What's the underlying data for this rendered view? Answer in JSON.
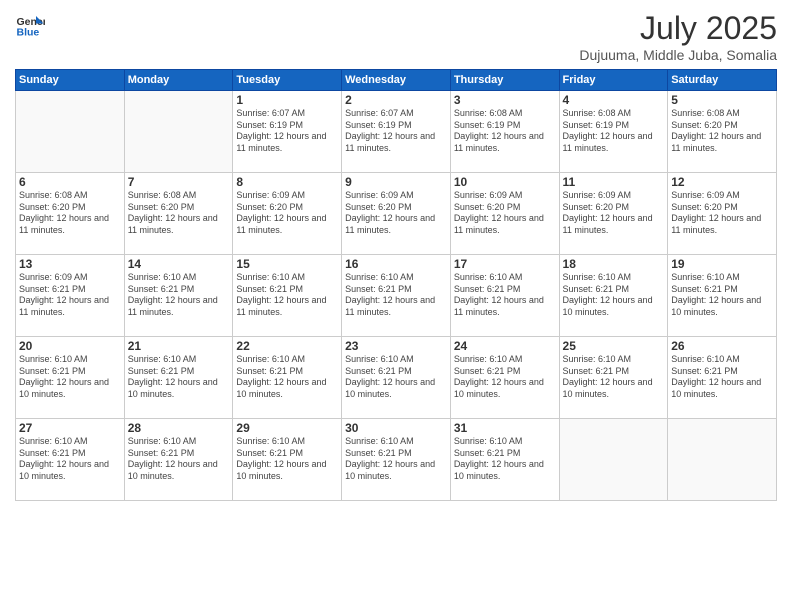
{
  "header": {
    "logo_general": "General",
    "logo_blue": "Blue",
    "title": "July 2025",
    "location": "Dujuuma, Middle Juba, Somalia"
  },
  "weekdays": [
    "Sunday",
    "Monday",
    "Tuesday",
    "Wednesday",
    "Thursday",
    "Friday",
    "Saturday"
  ],
  "weeks": [
    [
      {
        "day": "",
        "info": ""
      },
      {
        "day": "",
        "info": ""
      },
      {
        "day": "1",
        "info": "Sunrise: 6:07 AM\nSunset: 6:19 PM\nDaylight: 12 hours and 11 minutes."
      },
      {
        "day": "2",
        "info": "Sunrise: 6:07 AM\nSunset: 6:19 PM\nDaylight: 12 hours and 11 minutes."
      },
      {
        "day": "3",
        "info": "Sunrise: 6:08 AM\nSunset: 6:19 PM\nDaylight: 12 hours and 11 minutes."
      },
      {
        "day": "4",
        "info": "Sunrise: 6:08 AM\nSunset: 6:19 PM\nDaylight: 12 hours and 11 minutes."
      },
      {
        "day": "5",
        "info": "Sunrise: 6:08 AM\nSunset: 6:20 PM\nDaylight: 12 hours and 11 minutes."
      }
    ],
    [
      {
        "day": "6",
        "info": "Sunrise: 6:08 AM\nSunset: 6:20 PM\nDaylight: 12 hours and 11 minutes."
      },
      {
        "day": "7",
        "info": "Sunrise: 6:08 AM\nSunset: 6:20 PM\nDaylight: 12 hours and 11 minutes."
      },
      {
        "day": "8",
        "info": "Sunrise: 6:09 AM\nSunset: 6:20 PM\nDaylight: 12 hours and 11 minutes."
      },
      {
        "day": "9",
        "info": "Sunrise: 6:09 AM\nSunset: 6:20 PM\nDaylight: 12 hours and 11 minutes."
      },
      {
        "day": "10",
        "info": "Sunrise: 6:09 AM\nSunset: 6:20 PM\nDaylight: 12 hours and 11 minutes."
      },
      {
        "day": "11",
        "info": "Sunrise: 6:09 AM\nSunset: 6:20 PM\nDaylight: 12 hours and 11 minutes."
      },
      {
        "day": "12",
        "info": "Sunrise: 6:09 AM\nSunset: 6:20 PM\nDaylight: 12 hours and 11 minutes."
      }
    ],
    [
      {
        "day": "13",
        "info": "Sunrise: 6:09 AM\nSunset: 6:21 PM\nDaylight: 12 hours and 11 minutes."
      },
      {
        "day": "14",
        "info": "Sunrise: 6:10 AM\nSunset: 6:21 PM\nDaylight: 12 hours and 11 minutes."
      },
      {
        "day": "15",
        "info": "Sunrise: 6:10 AM\nSunset: 6:21 PM\nDaylight: 12 hours and 11 minutes."
      },
      {
        "day": "16",
        "info": "Sunrise: 6:10 AM\nSunset: 6:21 PM\nDaylight: 12 hours and 11 minutes."
      },
      {
        "day": "17",
        "info": "Sunrise: 6:10 AM\nSunset: 6:21 PM\nDaylight: 12 hours and 11 minutes."
      },
      {
        "day": "18",
        "info": "Sunrise: 6:10 AM\nSunset: 6:21 PM\nDaylight: 12 hours and 10 minutes."
      },
      {
        "day": "19",
        "info": "Sunrise: 6:10 AM\nSunset: 6:21 PM\nDaylight: 12 hours and 10 minutes."
      }
    ],
    [
      {
        "day": "20",
        "info": "Sunrise: 6:10 AM\nSunset: 6:21 PM\nDaylight: 12 hours and 10 minutes."
      },
      {
        "day": "21",
        "info": "Sunrise: 6:10 AM\nSunset: 6:21 PM\nDaylight: 12 hours and 10 minutes."
      },
      {
        "day": "22",
        "info": "Sunrise: 6:10 AM\nSunset: 6:21 PM\nDaylight: 12 hours and 10 minutes."
      },
      {
        "day": "23",
        "info": "Sunrise: 6:10 AM\nSunset: 6:21 PM\nDaylight: 12 hours and 10 minutes."
      },
      {
        "day": "24",
        "info": "Sunrise: 6:10 AM\nSunset: 6:21 PM\nDaylight: 12 hours and 10 minutes."
      },
      {
        "day": "25",
        "info": "Sunrise: 6:10 AM\nSunset: 6:21 PM\nDaylight: 12 hours and 10 minutes."
      },
      {
        "day": "26",
        "info": "Sunrise: 6:10 AM\nSunset: 6:21 PM\nDaylight: 12 hours and 10 minutes."
      }
    ],
    [
      {
        "day": "27",
        "info": "Sunrise: 6:10 AM\nSunset: 6:21 PM\nDaylight: 12 hours and 10 minutes."
      },
      {
        "day": "28",
        "info": "Sunrise: 6:10 AM\nSunset: 6:21 PM\nDaylight: 12 hours and 10 minutes."
      },
      {
        "day": "29",
        "info": "Sunrise: 6:10 AM\nSunset: 6:21 PM\nDaylight: 12 hours and 10 minutes."
      },
      {
        "day": "30",
        "info": "Sunrise: 6:10 AM\nSunset: 6:21 PM\nDaylight: 12 hours and 10 minutes."
      },
      {
        "day": "31",
        "info": "Sunrise: 6:10 AM\nSunset: 6:21 PM\nDaylight: 12 hours and 10 minutes."
      },
      {
        "day": "",
        "info": ""
      },
      {
        "day": "",
        "info": ""
      }
    ]
  ]
}
